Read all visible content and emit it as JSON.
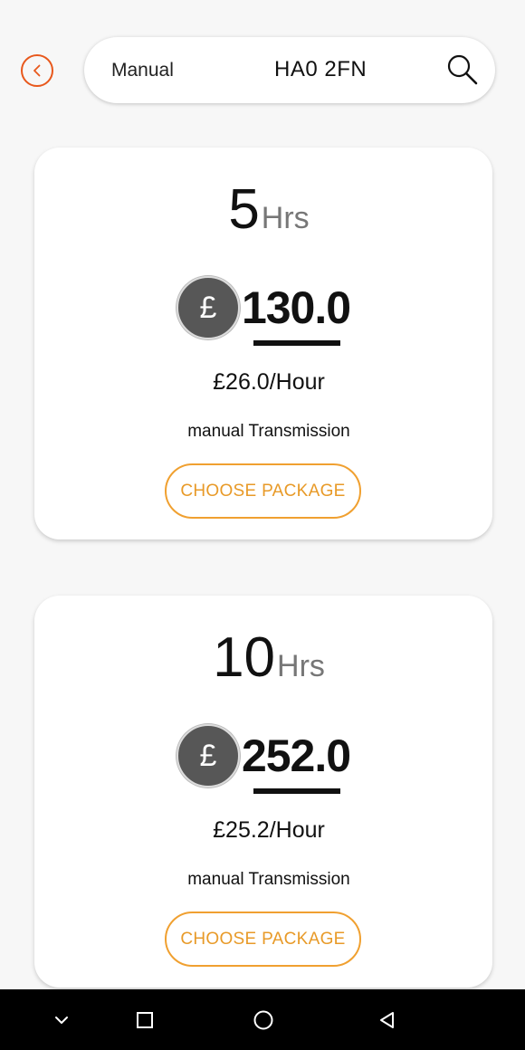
{
  "header": {
    "back_icon": "chevron-left-circle-icon",
    "search": {
      "mode": "Manual",
      "postcode": "HA0 2FN",
      "search_icon": "magnifier-icon"
    }
  },
  "packages": [
    {
      "hours": "5",
      "hours_unit": "Hrs",
      "currency_symbol": "£",
      "price": "130.0",
      "rate": "£26.0/Hour",
      "transmission": "manual Transmission",
      "button_label": "CHOOSE PACKAGE"
    },
    {
      "hours": "10",
      "hours_unit": "Hrs",
      "currency_symbol": "£",
      "price": "252.0",
      "rate": "£25.2/Hour",
      "transmission": "manual Transmission",
      "button_label": "CHOOSE PACKAGE"
    }
  ],
  "nav_bar": {
    "buttons": [
      "chevron-down-icon",
      "recents-square-icon",
      "home-circle-icon",
      "back-triangle-icon"
    ]
  },
  "colors": {
    "accent_orange": "#e8581c",
    "button_orange": "#f0a030",
    "currency_circle": "#575757",
    "background": "#f7f7f7"
  }
}
